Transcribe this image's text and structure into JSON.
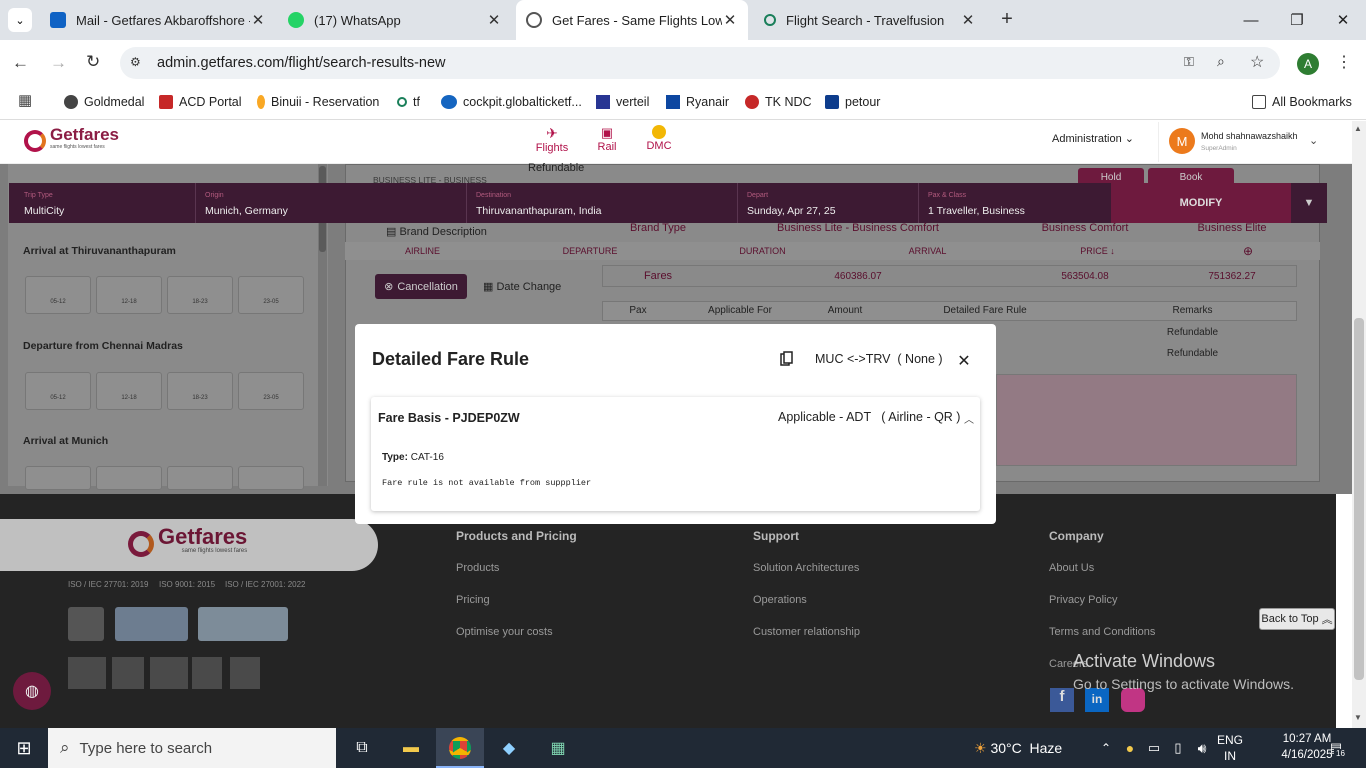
{
  "browser": {
    "tabs": [
      {
        "title": "Mail - Getfares Akbaroffshore -"
      },
      {
        "title": "(17) WhatsApp"
      },
      {
        "title": "Get Fares - Same Flights Lowest"
      },
      {
        "title": "Flight Search - Travelfusion"
      }
    ],
    "url": "admin.getfares.com/flight/search-results-new",
    "bookmarks": [
      "Goldmedal",
      "ACD Portal",
      "Binuii - Reservation",
      "tf",
      "cockpit.globalticketf...",
      "verteil",
      "Ryanair",
      "TK NDC",
      "petour"
    ],
    "all_bookmarks": "All Bookmarks",
    "profile_initial": "A"
  },
  "app": {
    "logo": "Getfares",
    "logo_tagline": "same flights lowest fares",
    "nav": [
      {
        "label": "Flights"
      },
      {
        "label": "Rail"
      },
      {
        "label": "DMC"
      }
    ],
    "admin_label": "Administration",
    "user": {
      "initial": "M",
      "name": "Mohd shahnawazshaikh",
      "role": "SuperAdmin"
    }
  },
  "search": {
    "fields": [
      {
        "label": "Trip Type",
        "value": "MultiCity"
      },
      {
        "label": "Origin",
        "value": "Munich, Germany"
      },
      {
        "label": "Destination",
        "value": "Thiruvananthapuram, India"
      },
      {
        "label": "Depart",
        "value": "Sunday, Apr 27, 25"
      },
      {
        "label": "Pax & Class",
        "value": "1 Traveller, Business"
      }
    ],
    "modify_label": "MODIFY"
  },
  "sidebar": {
    "sections": [
      {
        "label": "Arrival at Thiruvananthapuram",
        "slots": [
          "05-12",
          "12-18",
          "18-23",
          "23-05"
        ]
      },
      {
        "label": "Departure from Chennai Madras",
        "slots": [
          "05-12",
          "12-18",
          "18-23",
          "23-05"
        ]
      },
      {
        "label": "Arrival at Munich",
        "slots": [
          "",
          "",
          "",
          ""
        ]
      }
    ]
  },
  "results": {
    "brand_partial": "BUSINESS LITE - BUSINESS",
    "refundable_top": "Refundable",
    "hold_label": "Hold",
    "book_label": "Book",
    "brand_description": "Brand Description",
    "brand_type": "Brand Type",
    "brands": [
      "Business Lite - Business Comfort",
      "Business Comfort",
      "Business Elite"
    ],
    "columns": [
      "AIRLINE",
      "DEPARTURE",
      "DURATION",
      "ARRIVAL",
      "PRICE"
    ],
    "cancellation": "Cancellation",
    "date_change": "Date Change",
    "fares_label": "Fares",
    "fares": [
      "460386.07",
      "563504.08",
      "751362.27"
    ],
    "pax_headers": [
      "Pax",
      "Applicable For",
      "Amount",
      "Detailed Fare Rule",
      "Remarks"
    ],
    "remarks": [
      "Refundable",
      "Refundable"
    ]
  },
  "modal": {
    "title": "Detailed Fare Rule",
    "route": "MUC <->TRV  ( None )",
    "fare_basis": "Fare Basis - PJDEP0ZW",
    "applicable": "Applicable - ADT   ( Airline - QR )",
    "type_label": "Type:",
    "type_value": "CAT-16",
    "note": "Fare rule is not available from suppplier"
  },
  "footer": {
    "logo": "Getfares",
    "tagline": "same flights lowest fares",
    "iso": [
      "ISO / IEC 27701: 2019",
      "ISO 9001: 2015",
      "ISO / IEC 27001: 2022"
    ],
    "columns": [
      {
        "title": "Products and Pricing",
        "links": [
          "Products",
          "Pricing",
          "Optimise your costs"
        ]
      },
      {
        "title": "Support",
        "links": [
          "Solution Architectures",
          "Operations",
          "Customer relationship"
        ]
      },
      {
        "title": "Company",
        "links": [
          "About Us",
          "Privacy Policy",
          "Terms and Conditions",
          "Careers"
        ]
      }
    ],
    "back_to_top": "Back to Top"
  },
  "watermark": {
    "line1": "Activate Windows",
    "line2": "Go to Settings to activate Windows."
  },
  "taskbar": {
    "search_placeholder": "Type here to search",
    "weather": "30°C  Haze",
    "lang1": "ENG",
    "lang2": "IN",
    "time": "10:27 AM",
    "date": "4/16/2025",
    "notifications": "16"
  },
  "colors": {
    "brand": "#b1124a",
    "searchbar": "#3d1a33",
    "taskbar": "#202935"
  }
}
